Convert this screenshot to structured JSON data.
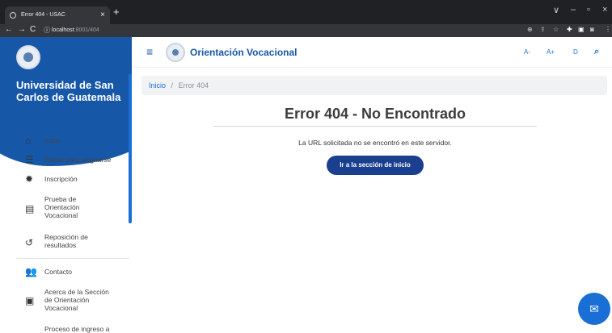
{
  "browser": {
    "tab_title": "Error 404 - USAC",
    "tab_close": "×",
    "new_tab": "+",
    "url_host": "localhost",
    "url_path": ":8001/404",
    "nav_back": "←",
    "nav_forward": "→",
    "nav_reload": "C",
    "site_info": "ⓘ",
    "window_controls": {
      "collapse": "∨",
      "minimize": "–",
      "restore": "▫",
      "close": "×"
    },
    "toolbar_icons": [
      "zoom-icon",
      "share-icon",
      "bookmark-star-icon",
      "extensions-icon",
      "sidepanel-icon",
      "profile-icon",
      "menu-icon"
    ]
  },
  "sidebar": {
    "university": "Universidad de San Carlos de Guatemala",
    "items": [
      {
        "label": "Inicio",
        "icon": "home-icon"
      },
      {
        "label": "Pasos para asignarse",
        "icon": "list-icon"
      },
      {
        "label": "Inscripción",
        "icon": "gear-badge-icon"
      },
      {
        "label": "Prueba de Orientación Vocacional",
        "icon": "clipboard-icon"
      },
      {
        "label": "Reposición de resultados",
        "icon": "history-icon"
      },
      {
        "label": "Contacto",
        "icon": "people-icon"
      },
      {
        "label": "Acerca de la Sección de Orientación Vocacional",
        "icon": "info-message-icon"
      },
      {
        "label": "Proceso de ingreso a",
        "icon": "document-icon"
      }
    ]
  },
  "header": {
    "title": "Orientación Vocacional",
    "tools": {
      "decrease_font": "A-",
      "increase_font": "A+",
      "dyslexia": "D",
      "search": "Q"
    }
  },
  "breadcrumb": {
    "home": "Inicio",
    "separator": "/",
    "current": "Error 404"
  },
  "main": {
    "title": "Error 404 - No Encontrado",
    "message": "La URL solicitada no se encontró en este servidor.",
    "button": "Ir a la sección de inicio"
  },
  "colors": {
    "primary": "#1757a8",
    "accent": "#1a6fd6",
    "button": "#1a3f8f"
  }
}
